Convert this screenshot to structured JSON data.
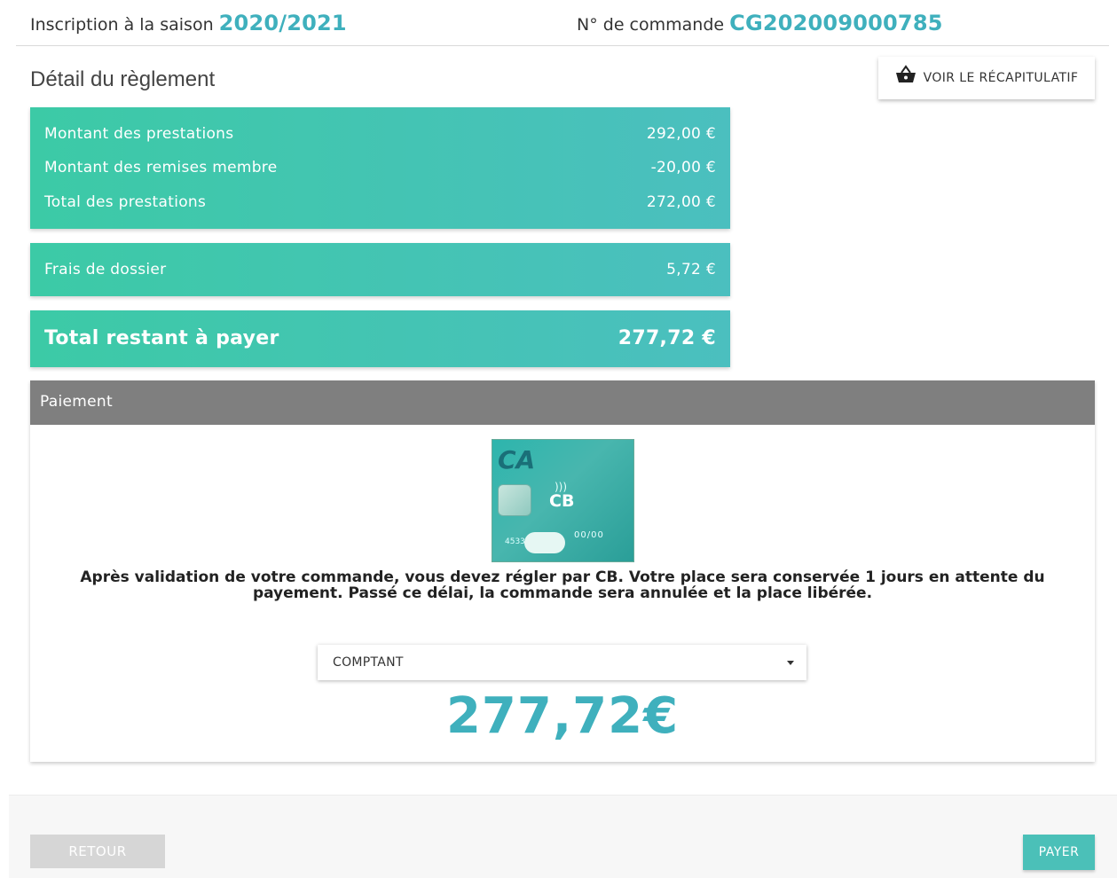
{
  "header": {
    "season_label": "Inscription à la saison",
    "season_value": "2020/2021",
    "order_label": "N° de commande",
    "order_value": "CG202009000785"
  },
  "section_title": "Détail du règlement",
  "recap_button": {
    "label": "VOIR LE RÉCAPITULATIF",
    "icon": "basket-icon"
  },
  "summary": {
    "rows": [
      {
        "label": "Montant des prestations",
        "value": "292,00 €"
      },
      {
        "label": "Montant des remises membre",
        "value": "-20,00 €"
      },
      {
        "label": "Total des prestations",
        "value": "272,00 €"
      }
    ],
    "fees": {
      "label": "Frais de dossier",
      "value": "5,72 €"
    },
    "total": {
      "label": "Total restant à payer",
      "value": "277,72 €"
    }
  },
  "payment": {
    "title": "Paiement",
    "card_logo": {
      "bank_mark": "CA",
      "brand": "CB",
      "number_fragment": "4533",
      "expiry": "00/00"
    },
    "message": "Après validation de votre commande, vous devez régler par CB. Votre place sera conservée 1 jours en attente du payement. Passé ce délai, la commande sera annulée et la place libérée.",
    "mode_selected": "COMPTANT",
    "amount": "277,72€"
  },
  "footer": {
    "back_label": "RETOUR",
    "pay_label": "PAYER"
  },
  "colors": {
    "accent": "#3fb0bd",
    "panel_start": "#3ccaa6",
    "panel_end": "#4bbfbf",
    "header_gray": "#7f7f7f",
    "pay_button": "#4bc0b8"
  }
}
